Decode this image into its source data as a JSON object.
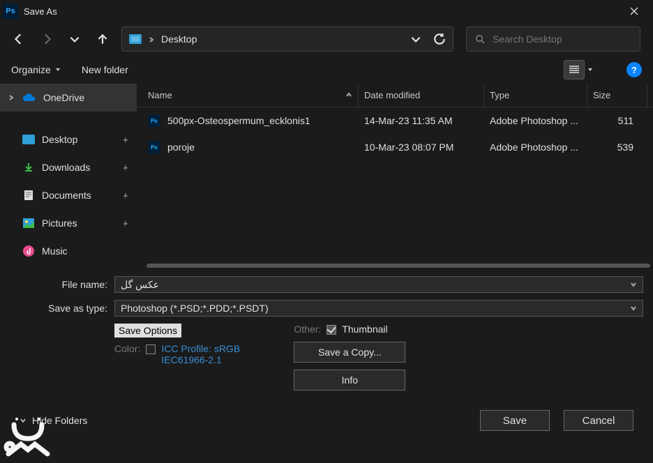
{
  "window": {
    "title": "Save As"
  },
  "breadcrumb": {
    "location": "Desktop"
  },
  "search": {
    "placeholder": "Search Desktop"
  },
  "toolbar": {
    "organize": "Organize",
    "new_folder": "New folder",
    "help": "?"
  },
  "tree": {
    "items": [
      {
        "label": "OneDrive"
      },
      {
        "label": "Desktop"
      },
      {
        "label": "Downloads"
      },
      {
        "label": "Documents"
      },
      {
        "label": "Pictures"
      },
      {
        "label": "Music"
      }
    ]
  },
  "columns": {
    "name": "Name",
    "date": "Date modified",
    "type": "Type",
    "size": "Size"
  },
  "files": [
    {
      "name": "500px-Osteospermum_ecklonis1",
      "date": "14-Mar-23 11:35 AM",
      "type": "Adobe Photoshop ...",
      "size": "511"
    },
    {
      "name": "poroje",
      "date": "10-Mar-23 08:07 PM",
      "type": "Adobe Photoshop ...",
      "size": "539"
    }
  ],
  "fields": {
    "file_name_label": "File name:",
    "file_name_value": "عکس گل",
    "save_type_label": "Save as type:",
    "save_type_value": "Photoshop (*.PSD;*.PDD;*.PSDT)"
  },
  "options": {
    "heading": "Save Options",
    "color_label": "Color:",
    "icc_profile": "ICC Profile:  sRGB IEC61966-2.1",
    "other_label": "Other:",
    "thumbnail_label": "Thumbnail",
    "save_copy": "Save a Copy...",
    "info": "Info"
  },
  "footer": {
    "hide_folders": "Hide Folders",
    "save": "Save",
    "cancel": "Cancel"
  }
}
